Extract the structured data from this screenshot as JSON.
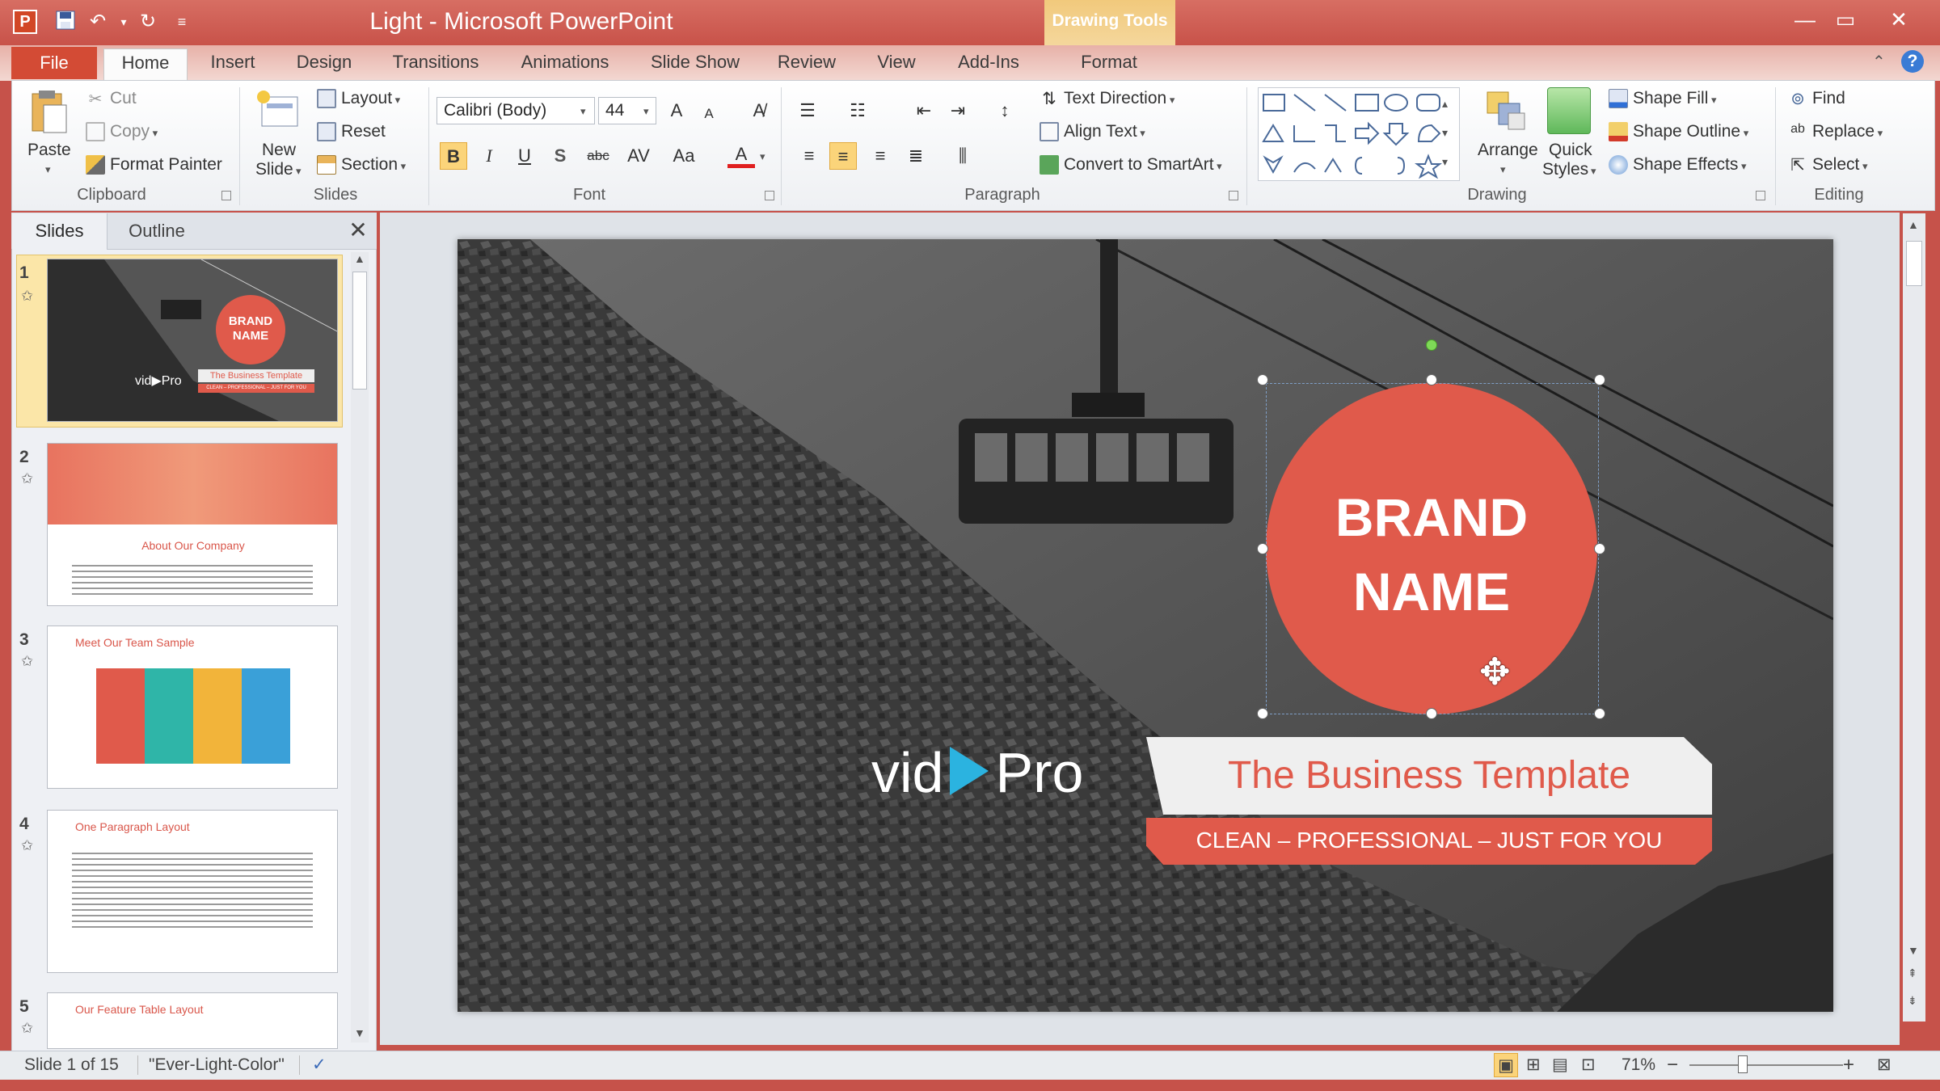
{
  "window": {
    "title": "Light  -  Microsoft PowerPoint",
    "contextual_tab_group": "Drawing Tools",
    "minimize": "—",
    "maximize": "▭",
    "close": "✕"
  },
  "tabs": [
    "File",
    "Home",
    "Insert",
    "Design",
    "Transitions",
    "Animations",
    "Slide Show",
    "Review",
    "View",
    "Add-Ins",
    "Format"
  ],
  "ribbon": {
    "clipboard": {
      "paste": "Paste",
      "cut": "Cut",
      "copy": "Copy",
      "format_painter": "Format Painter",
      "label": "Clipboard"
    },
    "slides": {
      "new_slide_1": "New",
      "new_slide_2": "Slide",
      "layout": "Layout",
      "reset": "Reset",
      "section": "Section",
      "label": "Slides"
    },
    "font": {
      "font_name": "Calibri (Body)",
      "font_size": "44",
      "bold": "B",
      "italic": "I",
      "underline": "U",
      "shadow": "S",
      "strike": "abc",
      "spacing": "AV",
      "case": "Aa",
      "color": "A",
      "grow": "A",
      "shrink": "A",
      "label": "Font"
    },
    "paragraph": {
      "text_direction": "Text Direction",
      "align_text": "Align Text",
      "convert_smartart": "Convert to SmartArt",
      "label": "Paragraph"
    },
    "drawing": {
      "arrange": "Arrange",
      "quick_styles_1": "Quick",
      "quick_styles_2": "Styles",
      "shape_fill": "Shape Fill",
      "shape_outline": "Shape Outline",
      "shape_effects": "Shape Effects",
      "label": "Drawing"
    },
    "editing": {
      "find": "Find",
      "replace": "Replace",
      "select": "Select",
      "label": "Editing"
    }
  },
  "pane": {
    "tab_slides": "Slides",
    "tab_outline": "Outline",
    "close": "✕",
    "thumbs": [
      {
        "num": "1",
        "brand": "BRAND NAME",
        "logo": "vid▶Pro",
        "tagline": "The Business Template",
        "subtag": "CLEAN – PROFESSIONAL – JUST FOR YOU"
      },
      {
        "num": "2",
        "title": "About Our Company"
      },
      {
        "num": "3",
        "title": "Meet Our Team Sample"
      },
      {
        "num": "4",
        "title": "One Paragraph Layout"
      },
      {
        "num": "5",
        "title": "Our Feature Table Layout"
      }
    ]
  },
  "slide": {
    "brand_line1": "BRAND",
    "brand_line2": "NAME",
    "logo_left": "vid",
    "logo_right": "Pro",
    "tagline": "The Business Template",
    "subtagline": "CLEAN – PROFESSIONAL – JUST FOR YOU"
  },
  "status": {
    "slide_counter": "Slide 1 of 15",
    "theme": "\"Ever-Light-Color\"",
    "zoom": "71%",
    "zoom_out": "−",
    "zoom_in": "+"
  },
  "colors": {
    "accent": "#e05a4b",
    "title_bar": "#c85249",
    "selection": "#fbe6a8"
  }
}
